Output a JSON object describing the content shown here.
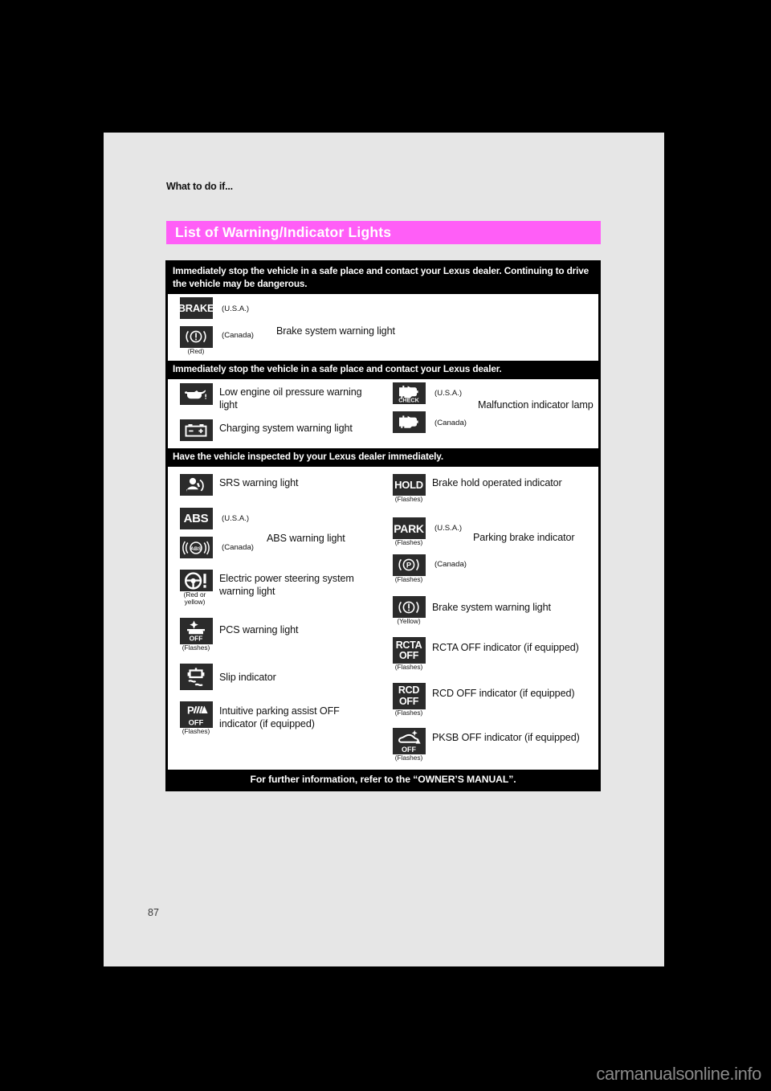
{
  "page": {
    "chapter": "What to do if...",
    "section_title": "List of Warning/Indicator Lights",
    "page_number": "87",
    "watermark": "carmanualsonline.info",
    "accent_color": "#ff5ef7"
  },
  "groups": [
    {
      "banner": "Immediately stop the vehicle in a safe place and contact your Lexus dealer. Continuing to drive the vehicle may be dangerous.",
      "rows": [
        {
          "type": "stacked",
          "label": "Brake system warning light",
          "icons": [
            {
              "glyph": "BRAKE",
              "kind": "text",
              "region": "(U.S.A.)",
              "note": ""
            },
            {
              "glyph": "brake-circle",
              "kind": "shape",
              "region": "(Canada)",
              "note": "(Red)"
            }
          ]
        }
      ]
    },
    {
      "banner": "Immediately stop the vehicle in a safe place and contact your Lexus dealer.",
      "left": [
        {
          "icon": "oil-can-icon",
          "kind": "shape",
          "label": "Low engine oil pressure warning light",
          "note": ""
        },
        {
          "icon": "battery-icon",
          "kind": "shape",
          "label": "Charging system warning light",
          "note": ""
        }
      ],
      "right": [
        {
          "type": "stacked",
          "label": "Malfunction indicator lamp",
          "icons": [
            {
              "glyph": "check-engine-check",
              "kind": "shape",
              "region": "(U.S.A.)",
              "note": ""
            },
            {
              "glyph": "check-engine",
              "kind": "shape",
              "region": "(Canada)",
              "note": ""
            }
          ]
        }
      ]
    },
    {
      "banner": "Have the vehicle inspected by your Lexus dealer immediately.",
      "left": [
        {
          "icon": "srs-airbag-icon",
          "kind": "shape",
          "label": "SRS warning light",
          "note": ""
        },
        {
          "type": "stacked",
          "label": "ABS warning light",
          "icons": [
            {
              "glyph": "ABS",
              "kind": "text",
              "region": "(U.S.A.)",
              "note": ""
            },
            {
              "glyph": "abs-circle",
              "kind": "shape",
              "region": "(Canada)",
              "note": ""
            }
          ]
        },
        {
          "icon": "steering-wheel-icon",
          "kind": "shape",
          "label": "Electric power steering system warning light",
          "note": "(Red or yellow)"
        },
        {
          "icon": "pcs-off-icon",
          "kind": "shape",
          "label": "PCS warning light",
          "note": "(Flashes)"
        },
        {
          "icon": "slip-icon",
          "kind": "shape",
          "label": "Slip indicator",
          "note": ""
        },
        {
          "icon": "parking-assist-off-icon",
          "kind": "shape",
          "label": "Intuitive parking assist OFF indicator (if equipped)",
          "note": "(Flashes)"
        }
      ],
      "right": [
        {
          "icon": "hold-icon",
          "kind": "text",
          "glyph": "HOLD",
          "label": "Brake hold operated indicator",
          "note": "(Flashes)"
        },
        {
          "type": "stacked",
          "label": "Parking brake indicator",
          "icons": [
            {
              "glyph": "PARK",
              "kind": "text",
              "region": "(U.S.A.)",
              "note": "(Flashes)"
            },
            {
              "glyph": "park-circle",
              "kind": "shape",
              "region": "(Canada)",
              "note": "(Flashes)"
            }
          ]
        },
        {
          "icon": "brake-circle-yellow-icon",
          "kind": "shape",
          "label": "Brake system warning light",
          "note": "(Yellow)"
        },
        {
          "icon": "rcta-off-icon",
          "kind": "text2",
          "glyph": "RCTA",
          "glyph2": "OFF",
          "label": "RCTA OFF indicator (if equipped)",
          "note": "(Flashes)"
        },
        {
          "icon": "rcd-off-icon",
          "kind": "text2",
          "glyph": "RCD",
          "glyph2": "OFF",
          "label": "RCD OFF indicator (if equipped)",
          "note": "(Flashes)"
        },
        {
          "icon": "pksb-off-icon",
          "kind": "shape",
          "label": "PKSB OFF indicator (if equipped)",
          "note": "(Flashes)"
        }
      ]
    }
  ],
  "footer": "For further information, refer to the “OWNER’S MANUAL”."
}
